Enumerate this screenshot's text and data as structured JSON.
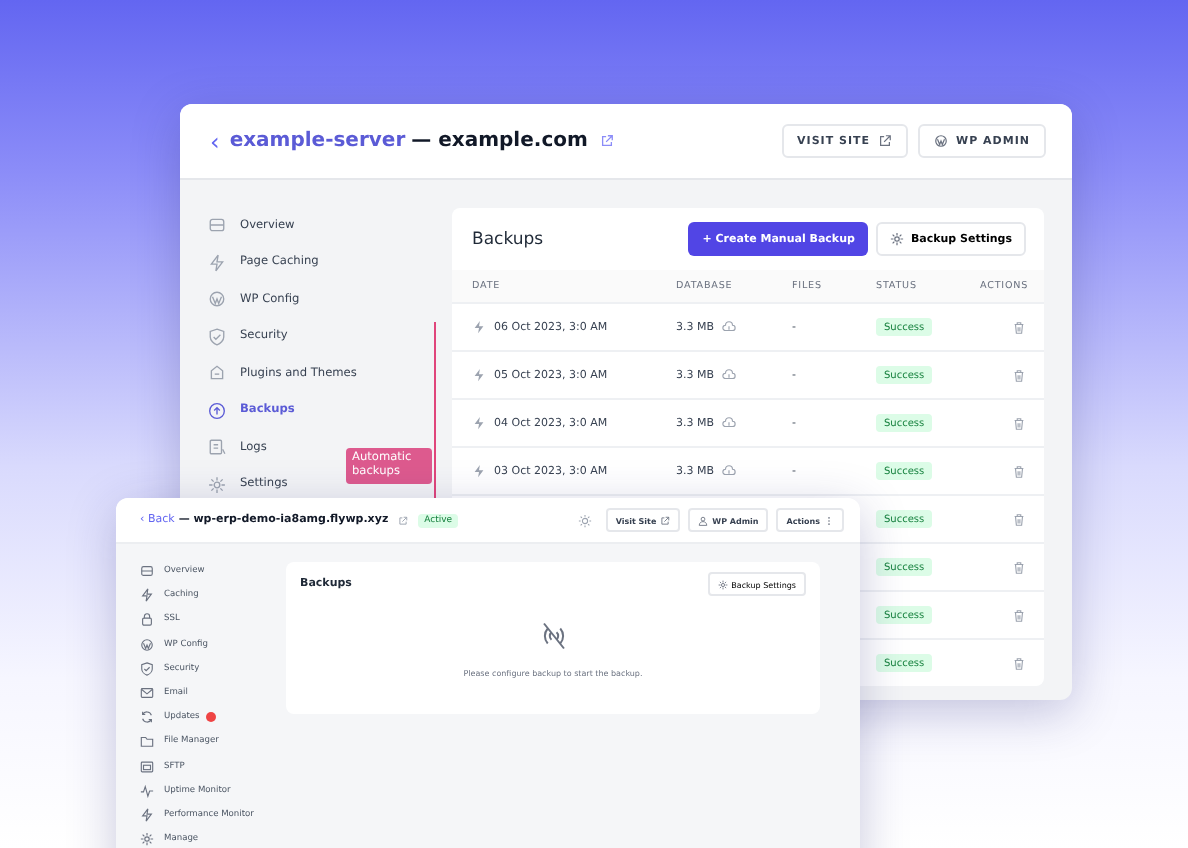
{
  "back_window": {
    "header": {
      "back_icon": "‹",
      "server": "example-server",
      "separator": " — ",
      "domain": "example.com",
      "buttons": [
        {
          "label": "VISIT SITE",
          "kind": "external"
        },
        {
          "label": "WP ADMIN",
          "kind": "wp"
        }
      ]
    },
    "sidebar": {
      "items": [
        {
          "label": "Overview",
          "selected": false
        },
        {
          "label": "Page Caching",
          "selected": false
        },
        {
          "label": "WP Config",
          "selected": false
        },
        {
          "label": "Security",
          "selected": false
        },
        {
          "label": "Plugins and Themes",
          "selected": false
        },
        {
          "label": "Backups",
          "selected": true
        },
        {
          "label": "Logs",
          "selected": false
        },
        {
          "label": "Settings",
          "selected": false
        }
      ]
    },
    "callout": {
      "text": "Automatic backups"
    },
    "backups": {
      "title": "Backups",
      "primary_button": {
        "icon": "+",
        "label": "Create Manual Backup"
      },
      "settings_button": {
        "label": "Backup Settings"
      },
      "columns": [
        "DATE",
        "DATABASE",
        "FILES",
        "STATUS",
        "ACTIONS"
      ],
      "rows": [
        {
          "kind": "full",
          "date": "06 Oct 2023, 3:0 AM",
          "database": "3.3 MB",
          "files": "-",
          "status": "Success"
        },
        {
          "kind": "full",
          "date": "05 Oct 2023, 3:0 AM",
          "database": "3.3 MB",
          "files": "-",
          "status": "Success"
        },
        {
          "kind": "full",
          "date": "04 Oct 2023, 3:0 AM",
          "database": "3.3 MB",
          "files": "-",
          "status": "Success"
        },
        {
          "kind": "full",
          "date": "03 Oct 2023, 3:0 AM",
          "database": "3.3 MB",
          "files": "-",
          "status": "Success"
        },
        {
          "kind": "covered",
          "status": "Success"
        },
        {
          "kind": "covered",
          "status": "Success"
        },
        {
          "kind": "covered",
          "status": "Success"
        },
        {
          "kind": "covered",
          "status": "Success"
        }
      ]
    }
  },
  "front_window": {
    "header": {
      "back_icon": "‹",
      "back_link": "Back",
      "separator": " — ",
      "domain": "wp-erp-demo-ia8amg.flywp.xyz",
      "status": "Active",
      "buttons": [
        {
          "label": "Visit Site",
          "kind": "external"
        },
        {
          "label": "WP Admin",
          "kind": "wp"
        },
        {
          "label": "Actions",
          "kind": "menu"
        }
      ]
    },
    "sidebar": {
      "items": [
        {
          "label": "Overview",
          "badge": false
        },
        {
          "label": "Caching",
          "badge": false
        },
        {
          "label": "SSL",
          "badge": false
        },
        {
          "label": "WP Config",
          "badge": false
        },
        {
          "label": "Security",
          "badge": false
        },
        {
          "label": "Email",
          "badge": false
        },
        {
          "label": "Updates",
          "badge": true
        },
        {
          "label": "File Manager",
          "badge": false
        },
        {
          "label": "SFTP",
          "badge": false
        },
        {
          "label": "Uptime Monitor",
          "badge": false
        },
        {
          "label": "Performance Monitor",
          "badge": false
        },
        {
          "label": "Manage",
          "badge": false
        }
      ]
    },
    "backups": {
      "title": "Backups",
      "settings_button": {
        "label": "Backup Settings"
      },
      "empty_message": "Please configure backup to start the backup."
    }
  }
}
